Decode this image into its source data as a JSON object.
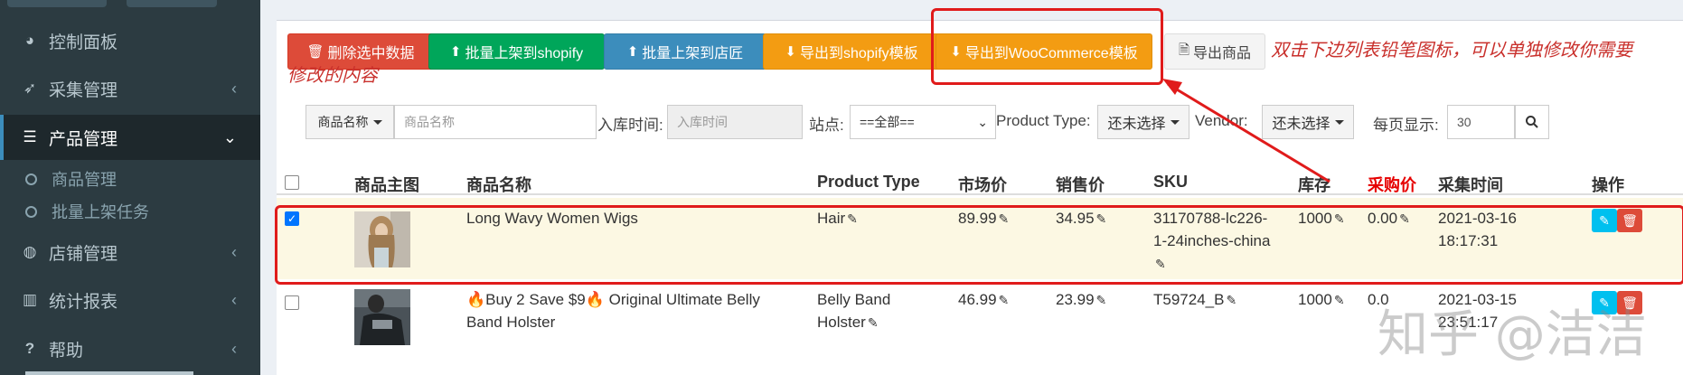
{
  "sidebar": {
    "items": [
      {
        "label": "控制面板",
        "icon": "dashboard-icon",
        "glyph": "◕"
      },
      {
        "label": "采集管理",
        "icon": "rocket-icon",
        "glyph": "➶"
      },
      {
        "label": "产品管理",
        "icon": "database-icon",
        "glyph": "☰"
      },
      {
        "label": "店铺管理",
        "icon": "globe-icon",
        "glyph": "◍"
      },
      {
        "label": "统计报表",
        "icon": "bar-chart-icon",
        "glyph": "▥"
      },
      {
        "label": "帮助",
        "icon": "question-icon",
        "glyph": "?"
      }
    ],
    "submenu": [
      {
        "label": "商品管理"
      },
      {
        "label": "批量上架任务"
      }
    ],
    "chevron_left": "‹",
    "chevron_down": "⌄"
  },
  "toolbar": {
    "delete_selected": "删除选中数据",
    "batch_shopify": "批量上架到shopify",
    "batch_shop": "批量上架到店匠",
    "export_shopify": "导出到shopify模板",
    "export_woo": "导出到WooCommerce模板",
    "export_products": "导出商品"
  },
  "annotation": {
    "line1": "双击下边列表铅笔图标，可以单独修改你需要",
    "line2": "修改的内容"
  },
  "filters": {
    "field_dropdown": "商品名称",
    "name_placeholder": "商品名称",
    "date_label": "入库时间:",
    "date_placeholder": "入库时间",
    "site_label": "站点:",
    "site_value": "==全部==",
    "product_type_label": "Product Type:",
    "product_type_value": "还未选择",
    "vendor_label": "Vendor:",
    "vendor_value": "还未选择",
    "per_page_label": "每页显示:",
    "per_page_value": "30"
  },
  "table": {
    "headers": {
      "image": "商品主图",
      "name": "商品名称",
      "type": "Product Type",
      "market_price": "市场价",
      "sale_price": "销售价",
      "sku": "SKU",
      "stock": "库存",
      "purchase_price": "采购价",
      "collected_at": "采集时间",
      "actions": "操作"
    },
    "rows": [
      {
        "checked": true,
        "name": "Long Wavy Women Wigs",
        "type": "Hair",
        "market_price": "89.99",
        "sale_price": "34.95",
        "sku_line1": "31170788-lc226-",
        "sku_line2": "1-24inches-china",
        "stock": "1000",
        "purchase_price": "0.00",
        "date": "2021-03-16",
        "time": "18:17:31"
      },
      {
        "checked": false,
        "name_line1": "🔥Buy 2 Save $9🔥 Original Ultimate Belly",
        "name_line2": "Band Holster",
        "type_line1": "Belly Band",
        "type_line2": "Holster",
        "market_price": "46.99",
        "sale_price": "23.99",
        "sku": "T59724_B",
        "stock": "1000",
        "purchase_price": "0.0",
        "date": "2021-03-15",
        "time": "23:51:17"
      }
    ]
  },
  "watermark": "知乎 @洁洁",
  "colors": {
    "sidebar_bg": "#2c3b41",
    "highlight_red": "#e01b1b",
    "purchase_price_header": "#e60000"
  }
}
